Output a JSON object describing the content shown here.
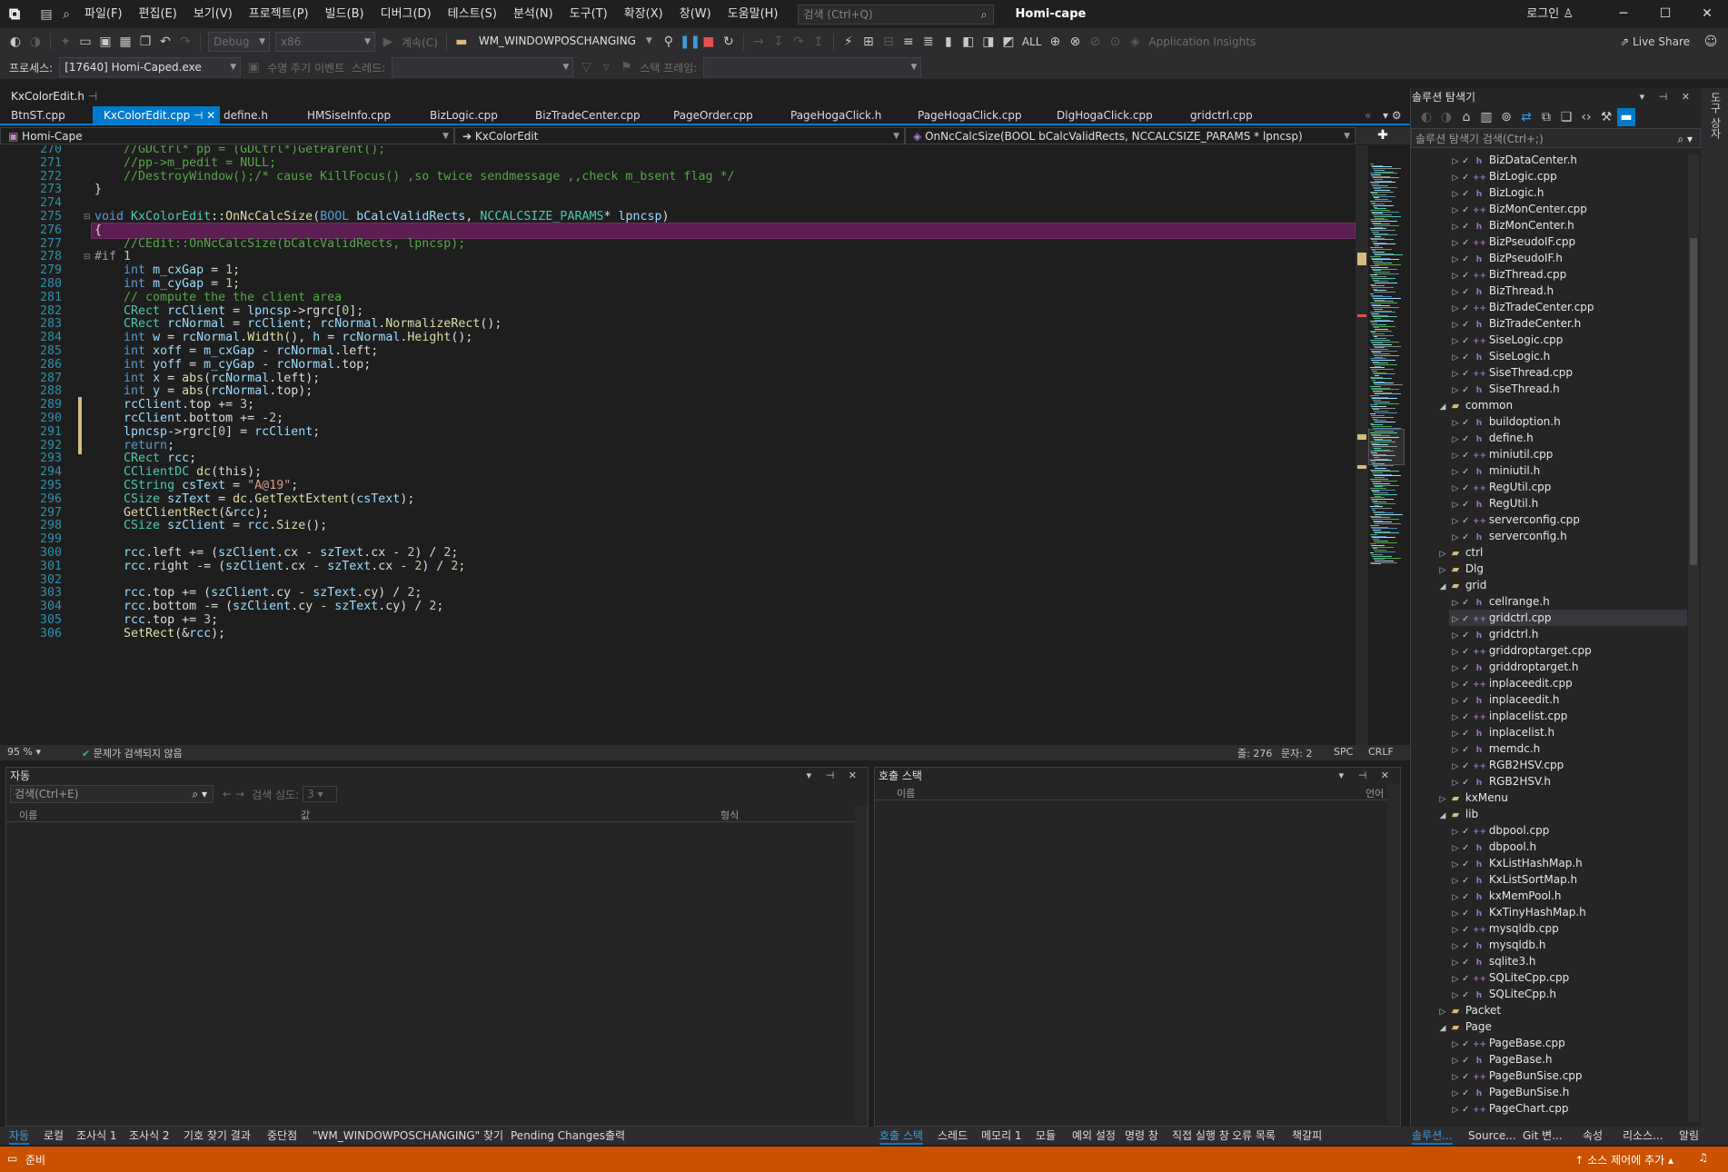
{
  "title_bar": {
    "menus": [
      "파일(F)",
      "편집(E)",
      "보기(V)",
      "프로젝트(P)",
      "빌드(B)",
      "디버그(D)",
      "테스트(S)",
      "분석(N)",
      "도구(T)",
      "확장(X)",
      "창(W)",
      "도움말(H)"
    ],
    "search_placeholder": "검색 (Ctrl+Q)",
    "app_title": "Homi-cape",
    "login": "로그인"
  },
  "toolbar": {
    "config": "Debug",
    "platform": "x86",
    "continue_label": "계속(C)",
    "message_combo": "WM_WINDOWPOSCHANGING",
    "all_label": "ALL",
    "app_insights": "Application Insights",
    "live_share": "Live Share",
    "process_label": "프로세스:",
    "process_value": "[17640] Homi-Caped.exe",
    "lifecycle_label": "수명 주기 이벤트",
    "thread_label": "스레드:",
    "stackframe_label": "스택 프레임:"
  },
  "document": {
    "pinned_title": "KxColorEdit.h",
    "tabs": [
      "BtnST.cpp",
      "KxColorEdit.cpp",
      "define.h",
      "HMSiseInfo.cpp",
      "BizLogic.cpp",
      "BizTradeCenter.cpp",
      "PageOrder.cpp",
      "PageHogaClick.h",
      "PageHogaClick.cpp",
      "DlgHogaClick.cpp",
      "gridctrl.cpp"
    ],
    "active_tab_index": 1,
    "nav_project": "Homi-Cape",
    "nav_class": "KxColorEdit",
    "nav_member": "OnNcCalcSize(BOOL bCalcValidRects, NCCALCSIZE_PARAMS * lpncsp)"
  },
  "editor": {
    "lines": [
      {
        "n": "270",
        "t": "    //GDCtrl* pp = (GDCtrl*)GetParent();",
        "k": "comment"
      },
      {
        "n": "271",
        "t": "    //pp->m_pedit = NULL;",
        "k": "comment"
      },
      {
        "n": "272",
        "t": "    //DestroyWindow();/* cause KillFocus() ,so twice sendmessage ,,check m_bsent flag */",
        "k": "comment"
      },
      {
        "n": "273",
        "t": "}",
        "k": "plain"
      },
      {
        "n": "274",
        "t": "",
        "k": "plain"
      },
      {
        "n": "275",
        "t": "void KxColorEdit::OnNcCalcSize(BOOL bCalcValidRects, NCCALCSIZE_PARAMS* lpncsp)",
        "k": "plain"
      },
      {
        "n": "276",
        "t": "{",
        "k": "plain"
      },
      {
        "n": "277",
        "t": "    //CEdit::OnNcCalcSize(bCalcValidRects, lpncsp);",
        "k": "comment"
      },
      {
        "n": "278",
        "t": "#if 1",
        "k": "plain"
      },
      {
        "n": "279",
        "t": "    int m_cxGap = 1;",
        "k": "plain"
      },
      {
        "n": "280",
        "t": "    int m_cyGap = 1;",
        "k": "plain"
      },
      {
        "n": "281",
        "t": "    // compute the the client area",
        "k": "comment"
      },
      {
        "n": "282",
        "t": "    CRect rcClient = lpncsp->rgrc[0];",
        "k": "plain"
      },
      {
        "n": "283",
        "t": "    CRect rcNormal = rcClient; rcNormal.NormalizeRect();",
        "k": "plain"
      },
      {
        "n": "284",
        "t": "    int w = rcNormal.Width(), h = rcNormal.Height();",
        "k": "plain"
      },
      {
        "n": "285",
        "t": "    int xoff = m_cxGap - rcNormal.left;",
        "k": "plain"
      },
      {
        "n": "286",
        "t": "    int yoff = m_cyGap - rcNormal.top;",
        "k": "plain"
      },
      {
        "n": "287",
        "t": "    int x = abs(rcNormal.left);",
        "k": "plain"
      },
      {
        "n": "288",
        "t": "    int y = abs(rcNormal.top);",
        "k": "plain"
      },
      {
        "n": "289",
        "t": "    rcClient.top += 3;",
        "k": "plain"
      },
      {
        "n": "290",
        "t": "    rcClient.bottom += -2;",
        "k": "plain"
      },
      {
        "n": "291",
        "t": "    lpncsp->rgrc[0] = rcClient;",
        "k": "plain"
      },
      {
        "n": "292",
        "t": "    return;",
        "k": "plain"
      },
      {
        "n": "293",
        "t": "    CRect rcc;",
        "k": "plain"
      },
      {
        "n": "294",
        "t": "    CClientDC dc(this);",
        "k": "plain"
      },
      {
        "n": "295",
        "t": "    CString csText = \"A@19\";",
        "k": "plain"
      },
      {
        "n": "296",
        "t": "    CSize szText = dc.GetTextExtent(csText);",
        "k": "plain"
      },
      {
        "n": "297",
        "t": "    GetClientRect(&rcc);",
        "k": "plain"
      },
      {
        "n": "298",
        "t": "    CSize szClient = rcc.Size();",
        "k": "plain"
      },
      {
        "n": "299",
        "t": "",
        "k": "plain"
      },
      {
        "n": "300",
        "t": "    rcc.left += (szClient.cx - szText.cx - 2) / 2;",
        "k": "plain"
      },
      {
        "n": "301",
        "t": "    rcc.right -= (szClient.cx - szText.cx - 2) / 2;",
        "k": "plain"
      },
      {
        "n": "302",
        "t": "",
        "k": "plain"
      },
      {
        "n": "303",
        "t": "    rcc.top += (szClient.cy - szText.cy) / 2;",
        "k": "plain"
      },
      {
        "n": "304",
        "t": "    rcc.bottom -= (szClient.cy - szText.cy) / 2;",
        "k": "plain"
      },
      {
        "n": "305",
        "t": "    rcc.top += 3;",
        "k": "plain"
      },
      {
        "n": "306",
        "t": "    SetRect(&rcc);",
        "k": "plain"
      }
    ],
    "highlighted_line": "276",
    "changed_lines": [
      "289",
      "290",
      "291",
      "292"
    ],
    "zoom": "95 %",
    "issues": "문제가 검색되지 않음",
    "line_pos": "줄: 276",
    "char_pos": "문자: 2",
    "spc": "SPC",
    "eol": "CRLF"
  },
  "solution_explorer": {
    "title": "솔루션 탐색기",
    "search_placeholder": "솔루션 탐색기 검색(Ctrl+;)",
    "items": [
      {
        "label": "BizDataCenter.h",
        "type": "h",
        "depth": 2
      },
      {
        "label": "BizLogic.cpp",
        "type": "cpp",
        "depth": 2
      },
      {
        "label": "BizLogic.h",
        "type": "h",
        "depth": 2
      },
      {
        "label": "BizMonCenter.cpp",
        "type": "cpp",
        "depth": 2
      },
      {
        "label": "BizMonCenter.h",
        "type": "h",
        "depth": 2
      },
      {
        "label": "BizPseudoIF.cpp",
        "type": "cpp",
        "depth": 2
      },
      {
        "label": "BizPseudoIF.h",
        "type": "h",
        "depth": 2
      },
      {
        "label": "BizThread.cpp",
        "type": "cpp",
        "depth": 2
      },
      {
        "label": "BizThread.h",
        "type": "h",
        "depth": 2
      },
      {
        "label": "BizTradeCenter.cpp",
        "type": "cpp",
        "depth": 2
      },
      {
        "label": "BizTradeCenter.h",
        "type": "h",
        "depth": 2
      },
      {
        "label": "SiseLogic.cpp",
        "type": "cpp",
        "depth": 2
      },
      {
        "label": "SiseLogic.h",
        "type": "h",
        "depth": 2
      },
      {
        "label": "SiseThread.cpp",
        "type": "cpp",
        "depth": 2
      },
      {
        "label": "SiseThread.h",
        "type": "h",
        "depth": 2
      },
      {
        "label": "common",
        "type": "folder-open",
        "depth": 1
      },
      {
        "label": "buildoption.h",
        "type": "h",
        "depth": 2
      },
      {
        "label": "define.h",
        "type": "h",
        "depth": 2
      },
      {
        "label": "miniutil.cpp",
        "type": "cpp",
        "depth": 2
      },
      {
        "label": "miniutil.h",
        "type": "h",
        "depth": 2
      },
      {
        "label": "RegUtil.cpp",
        "type": "cpp",
        "depth": 2
      },
      {
        "label": "RegUtil.h",
        "type": "h",
        "depth": 2
      },
      {
        "label": "serverconfig.cpp",
        "type": "cpp",
        "depth": 2
      },
      {
        "label": "serverconfig.h",
        "type": "h",
        "depth": 2
      },
      {
        "label": "ctrl",
        "type": "folder",
        "depth": 1
      },
      {
        "label": "Dlg",
        "type": "folder",
        "depth": 1
      },
      {
        "label": "grid",
        "type": "folder-open",
        "depth": 1
      },
      {
        "label": "cellrange.h",
        "type": "h",
        "depth": 2
      },
      {
        "label": "gridctrl.cpp",
        "type": "cpp",
        "depth": 2,
        "selected": true
      },
      {
        "label": "gridctrl.h",
        "type": "h",
        "depth": 2
      },
      {
        "label": "griddroptarget.cpp",
        "type": "cpp",
        "depth": 2
      },
      {
        "label": "griddroptarget.h",
        "type": "h",
        "depth": 2
      },
      {
        "label": "inplaceedit.cpp",
        "type": "cpp",
        "depth": 2
      },
      {
        "label": "inplaceedit.h",
        "type": "h",
        "depth": 2
      },
      {
        "label": "inplacelist.cpp",
        "type": "cpp",
        "depth": 2
      },
      {
        "label": "inplacelist.h",
        "type": "h",
        "depth": 2
      },
      {
        "label": "memdc.h",
        "type": "h",
        "depth": 2
      },
      {
        "label": "RGB2HSV.cpp",
        "type": "cpp",
        "depth": 2
      },
      {
        "label": "RGB2HSV.h",
        "type": "h",
        "depth": 2
      },
      {
        "label": "kxMenu",
        "type": "folder",
        "depth": 1
      },
      {
        "label": "lib",
        "type": "folder-open",
        "depth": 1
      },
      {
        "label": "dbpool.cpp",
        "type": "cpp",
        "depth": 2
      },
      {
        "label": "dbpool.h",
        "type": "h",
        "depth": 2
      },
      {
        "label": "KxListHashMap.h",
        "type": "h",
        "depth": 2
      },
      {
        "label": "KxListSortMap.h",
        "type": "h",
        "depth": 2
      },
      {
        "label": "kxMemPool.h",
        "type": "h",
        "depth": 2
      },
      {
        "label": "KxTinyHashMap.h",
        "type": "h",
        "depth": 2
      },
      {
        "label": "mysqldb.cpp",
        "type": "cpp",
        "depth": 2
      },
      {
        "label": "mysqldb.h",
        "type": "h",
        "depth": 2
      },
      {
        "label": "sqlite3.h",
        "type": "h",
        "depth": 2
      },
      {
        "label": "SQLiteCpp.cpp",
        "type": "cpp",
        "depth": 2
      },
      {
        "label": "SQLiteCpp.h",
        "type": "h",
        "depth": 2
      },
      {
        "label": "Packet",
        "type": "folder",
        "depth": 1
      },
      {
        "label": "Page",
        "type": "folder-open",
        "depth": 1
      },
      {
        "label": "PageBase.cpp",
        "type": "cpp",
        "depth": 2
      },
      {
        "label": "PageBase.h",
        "type": "h",
        "depth": 2
      },
      {
        "label": "PageBunSise.cpp",
        "type": "cpp",
        "depth": 2
      },
      {
        "label": "PageBunSise.h",
        "type": "h",
        "depth": 2
      },
      {
        "label": "PageChart.cpp",
        "type": "cpp",
        "depth": 2
      }
    ],
    "bottom_tabs": [
      "솔루션...",
      "Source...",
      "Git 변...",
      "속성",
      "리소스...",
      "알림"
    ]
  },
  "auto_panel": {
    "title": "자동",
    "search_placeholder": "검색(Ctrl+E)",
    "depth_label": "검색 심도:",
    "depth_value": "3",
    "col_name": "이름",
    "col_value": "값",
    "col_type": "형식"
  },
  "call_stack": {
    "title": "호출 스택",
    "col_name": "이름",
    "col_lang": "언어"
  },
  "left_bottom_tabs": [
    "자동",
    "로컬",
    "조사식 1",
    "조사식 2",
    "기호 찾기 결과",
    "중단점",
    "\"WM_WINDOWPOSCHANGING\" 찾기",
    "Pending Changes",
    "출력"
  ],
  "right_bottom_tabs": [
    "호출 스택",
    "스레드",
    "메모리 1",
    "모듈",
    "예외 설정",
    "명령 창",
    "직접 실행 창",
    "오류 목록",
    "책갈피"
  ],
  "status_bar": {
    "ready": "준비",
    "source_control": "소스 제어에 추가"
  },
  "right_strip": {
    "label": "도구 상자"
  },
  "colors": {
    "accent": "#007acc",
    "status_bar": "#ca5100",
    "highlight_line": "#5b1d52",
    "comment": "#57a64a",
    "keyword": "#569cd6",
    "type": "#4ec9b0",
    "string": "#d69d85"
  }
}
